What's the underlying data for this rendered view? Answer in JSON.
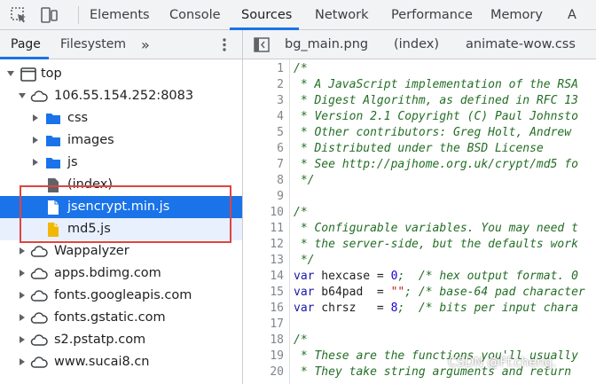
{
  "devtools_tabs": [
    "Elements",
    "Console",
    "Sources",
    "Network",
    "Performance",
    "Memory",
    "A"
  ],
  "active_tab": "Sources",
  "navigator": {
    "tabs": [
      "Page",
      "Filesystem"
    ],
    "more": "»"
  },
  "tree": [
    {
      "label": "top"
    },
    {
      "label": "106.55.154.252:8083"
    },
    {
      "label": "css"
    },
    {
      "label": "images"
    },
    {
      "label": "js"
    },
    {
      "label": "(index)"
    },
    {
      "label": "jsencrypt.min.js"
    },
    {
      "label": "md5.js"
    },
    {
      "label": "Wappalyzer"
    },
    {
      "label": "apps.bdimg.com"
    },
    {
      "label": "fonts.googleapis.com"
    },
    {
      "label": "fonts.gstatic.com"
    },
    {
      "label": "s2.pstatp.com"
    },
    {
      "label": "www.sucai8.cn"
    }
  ],
  "editor_tabs": [
    "bg_main.png",
    "(index)",
    "animate-wow.css"
  ],
  "code_lines": [
    "1",
    "2",
    "3",
    "4",
    "5",
    "6",
    "7",
    "8",
    "9",
    "10",
    "11",
    "12",
    "13",
    "14",
    "15",
    "16",
    "17",
    "18",
    "19",
    "20"
  ],
  "code": {
    "l1": "/*",
    "l2": " * A JavaScript implementation of the RSA",
    "l3": " * Digest Algorithm, as defined in RFC 13",
    "l4": " * Version 2.1 Copyright (C) Paul Johnsto",
    "l5": " * Other contributors: Greg Holt, Andrew",
    "l6": " * Distributed under the BSD License",
    "l7": " * See http://pajhome.org.uk/crypt/md5 fo",
    "l8": " */",
    "l10": "/*",
    "l11": " * Configurable variables. You may need t",
    "l12": " * the server-side, but the defaults work",
    "l13": " */",
    "l14_kw": "var",
    "l14_id": " hexcase = ",
    "l14_num": "0",
    "l14_cm": ";  /* hex output format. 0",
    "l15_kw": "var",
    "l15_id": " b64pad  = ",
    "l15_str": "\"\"",
    "l15_cm": "; /* base-64 pad character",
    "l16_kw": "var",
    "l16_id": " chrsz   = ",
    "l16_num": "8",
    "l16_cm": ";  /* bits per input chara",
    "l18": "/*",
    "l19": " * These are the functions you'll usually",
    "l20": " * They take string arguments and return"
  },
  "watermark": "CSDN @Ff.cheng."
}
